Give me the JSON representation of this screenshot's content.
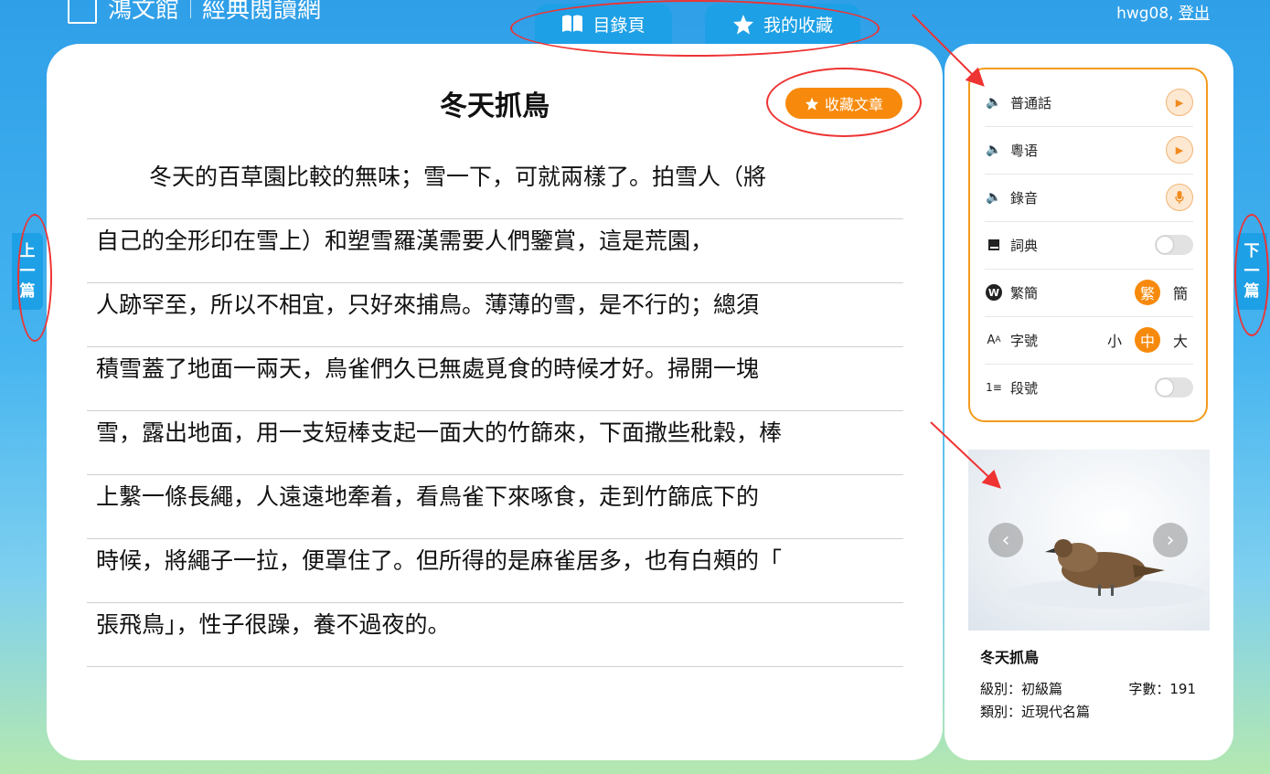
{
  "brand": {
    "name": "鴻文館",
    "tagline": "經典閱讀網"
  },
  "user": {
    "username": "hwg08,",
    "logout_label": "登出"
  },
  "top_tabs": {
    "contents_label": "目錄頁",
    "favorites_label": "我的收藏"
  },
  "nav": {
    "prev": [
      "上",
      "一",
      "篇"
    ],
    "next": [
      "下",
      "一",
      "篇"
    ]
  },
  "article": {
    "title": "冬天抓鳥",
    "collect_label": "收藏文章",
    "lines": [
      "冬天的百草園比較的無味；雪一下，可就兩樣了。拍雪人（將",
      "自己的全形印在雪上）和塑雪羅漢需要人們鑒賞，這是荒園，",
      "人跡罕至，所以不相宜，只好來捕鳥。薄薄的雪，是不行的；總須",
      "積雪蓋了地面一兩天，鳥雀們久已無處覓食的時候才好。掃開一塊",
      "雪，露出地面，用一支短棒支起一面大的竹篩來，下面撒些秕穀，棒",
      "上繫一條長繩，人遠遠地牽着，看鳥雀下來啄食，走到竹篩底下的",
      "時候，將繩子一拉，便罩住了。但所得的是麻雀居多，也有白頰的「",
      "張飛鳥」，性子很躁，養不過夜的。"
    ]
  },
  "settings": {
    "mandarin": "普通話",
    "cantonese": "粵语",
    "recording": "錄音",
    "dictionary": "詞典",
    "script": {
      "label": "繁簡",
      "options": [
        "繁",
        "簡"
      ],
      "selected": "繁"
    },
    "font_size": {
      "label": "字號",
      "options": [
        "小",
        "中",
        "大"
      ],
      "selected": "中"
    },
    "paragraph_numbers": "段號"
  },
  "card": {
    "title": "冬天抓鳥",
    "level": "級別：初級篇",
    "word_count": "字數：191",
    "category": "類別：近現代名篇"
  },
  "colors": {
    "accent_blue": "#1ea0e6",
    "accent_orange": "#f78a0c",
    "annotation_red": "#e33333"
  }
}
